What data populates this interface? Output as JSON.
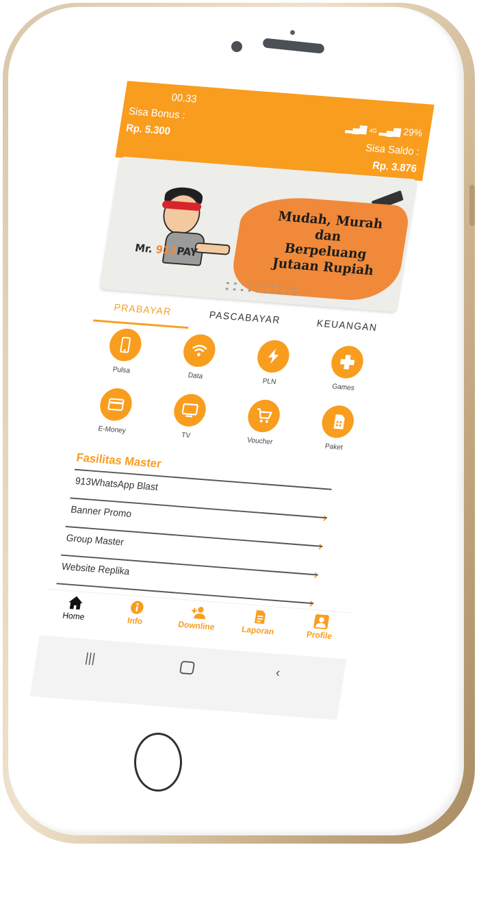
{
  "status_bar": {
    "time": "00.33",
    "signal": "4G",
    "battery": "29%"
  },
  "header": {
    "bonus_label": "Sisa Bonus :",
    "bonus_value": "Rp. 5.300",
    "saldo_label": "Sisa Saldo :",
    "saldo_value": "Rp. 3.876"
  },
  "banner": {
    "logo_prefix": "Mr.",
    "logo_number": "913",
    "logo_suffix": "PAY",
    "line1": "Mudah, Murah",
    "line2": "dan",
    "line3": "Berpeluang",
    "line4": "Jutaan Rupiah"
  },
  "tabs": [
    {
      "label": "PRABAYAR",
      "active": true
    },
    {
      "label": "PASCABAYAR",
      "active": false
    },
    {
      "label": "KEUANGAN",
      "active": false
    }
  ],
  "services": [
    {
      "label": "Pulsa",
      "icon": "phone-icon"
    },
    {
      "label": "Data",
      "icon": "wifi-icon"
    },
    {
      "label": "PLN",
      "icon": "bolt-icon"
    },
    {
      "label": "Games",
      "icon": "gamepad-icon"
    },
    {
      "label": "E-Money",
      "icon": "card-icon"
    },
    {
      "label": "TV",
      "icon": "tv-icon"
    },
    {
      "label": "Voucher",
      "icon": "cart-icon"
    },
    {
      "label": "Paket",
      "icon": "sim-icon"
    }
  ],
  "facilities": {
    "title": "Fasilitas Master",
    "items": [
      {
        "label": "913WhatsApp Blast"
      },
      {
        "label": "Banner Promo"
      },
      {
        "label": "Group Master"
      },
      {
        "label": "Website Replika"
      }
    ]
  },
  "bottom_nav": [
    {
      "label": "Home",
      "icon": "home-icon",
      "active": true
    },
    {
      "label": "Info",
      "icon": "info-icon",
      "active": false
    },
    {
      "label": "Downline",
      "icon": "add-user-icon",
      "active": false
    },
    {
      "label": "Laporan",
      "icon": "report-icon",
      "active": false
    },
    {
      "label": "Profile",
      "icon": "profile-icon",
      "active": false
    }
  ],
  "colors": {
    "accent": "#f99d1f",
    "text": "#333333"
  }
}
